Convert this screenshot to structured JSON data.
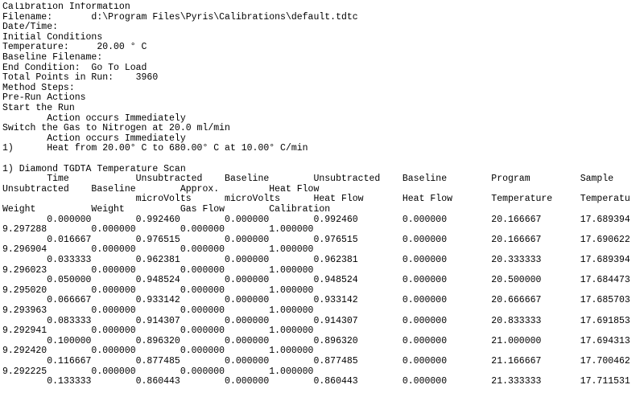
{
  "lines": [
    "Calibration Information",
    "Filename:       d:\\Program Files\\Pyris\\Calibrations\\default.tdtc",
    "Date/Time:",
    "Initial Conditions",
    "Temperature:     20.00 ° C",
    "Baseline Filename:",
    "End Condition:  Go To Load",
    "Total Points in Run:    3960",
    "Method Steps:",
    "Pre-Run Actions",
    "Start the Run",
    "        Action occurs Immediately",
    "Switch the Gas to Nitrogen at 20.0 ml/min",
    "        Action occurs Immediately",
    "1)      Heat from 20.00° C to 680.00° C at 10.00° C/min",
    "",
    "1) Diamond TGDTA Temperature Scan",
    "        Time            Unsubtracted    Baseline        Unsubtracted    Baseline        Program         Sample",
    "Unsubtracted    Baseline        Approx.         Heat Flow",
    "                        microVolts      microVolts      Heat Flow       Heat Flow       Temperature     Temperature",
    "Weight          Weight          Gas Flow        Calibration",
    "        0.000000        0.992460        0.000000        0.992460        0.000000        20.166667       17.689394",
    "9.297288        0.000000        0.000000        1.000000",
    "        0.016667        0.976515        0.000000        0.976515        0.000000        20.166667       17.690622",
    "9.296904        0.000000        0.000000        1.000000",
    "        0.033333        0.962381        0.000000        0.962381        0.000000        20.333333       17.689394",
    "9.296023        0.000000        0.000000        1.000000",
    "        0.050000        0.948524        0.000000        0.948524        0.000000        20.500000       17.684473",
    "9.295020        0.000000        0.000000        1.000000",
    "        0.066667        0.933142        0.000000        0.933142        0.000000        20.666667       17.685703",
    "9.293963        0.000000        0.000000        1.000000",
    "        0.083333        0.914307        0.000000        0.914307        0.000000        20.833333       17.691853",
    "9.292941        0.000000        0.000000        1.000000",
    "        0.100000        0.896320        0.000000        0.896320        0.000000        21.000000       17.694313",
    "9.292420        0.000000        0.000000        1.000000",
    "        0.116667        0.877485        0.000000        0.877485        0.000000        21.166667       17.700462",
    "9.292225        0.000000        0.000000        1.000000",
    "        0.133333        0.860443        0.000000        0.860443        0.000000        21.333333       17.711531"
  ]
}
